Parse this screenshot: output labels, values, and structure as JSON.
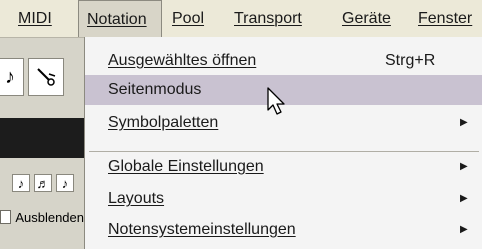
{
  "menubar": {
    "items": [
      {
        "label": "MIDI"
      },
      {
        "label": "Notation"
      },
      {
        "label": "Pool"
      },
      {
        "label": "Transport"
      },
      {
        "label": "Geräte"
      },
      {
        "label": "Fenster"
      }
    ]
  },
  "toolbar": {
    "hide_label": "Ausblenden"
  },
  "notation_menu": {
    "items": [
      {
        "label": "Ausgewähltes öffnen",
        "shortcut": "Strg+R"
      },
      {
        "label": "Seitenmodus"
      },
      {
        "label": "Symbolpaletten",
        "submenu": "▶"
      },
      {
        "label": "Globale Einstellungen",
        "submenu": "▶"
      },
      {
        "label": "Layouts",
        "submenu": "▶"
      },
      {
        "label": "Notensystemeinstellungen",
        "submenu": "▶"
      }
    ]
  },
  "colors": {
    "menubar_bg": "#ece9d8",
    "dropdown_bg": "#f4f4f4",
    "highlight": "#c9c2d1"
  }
}
